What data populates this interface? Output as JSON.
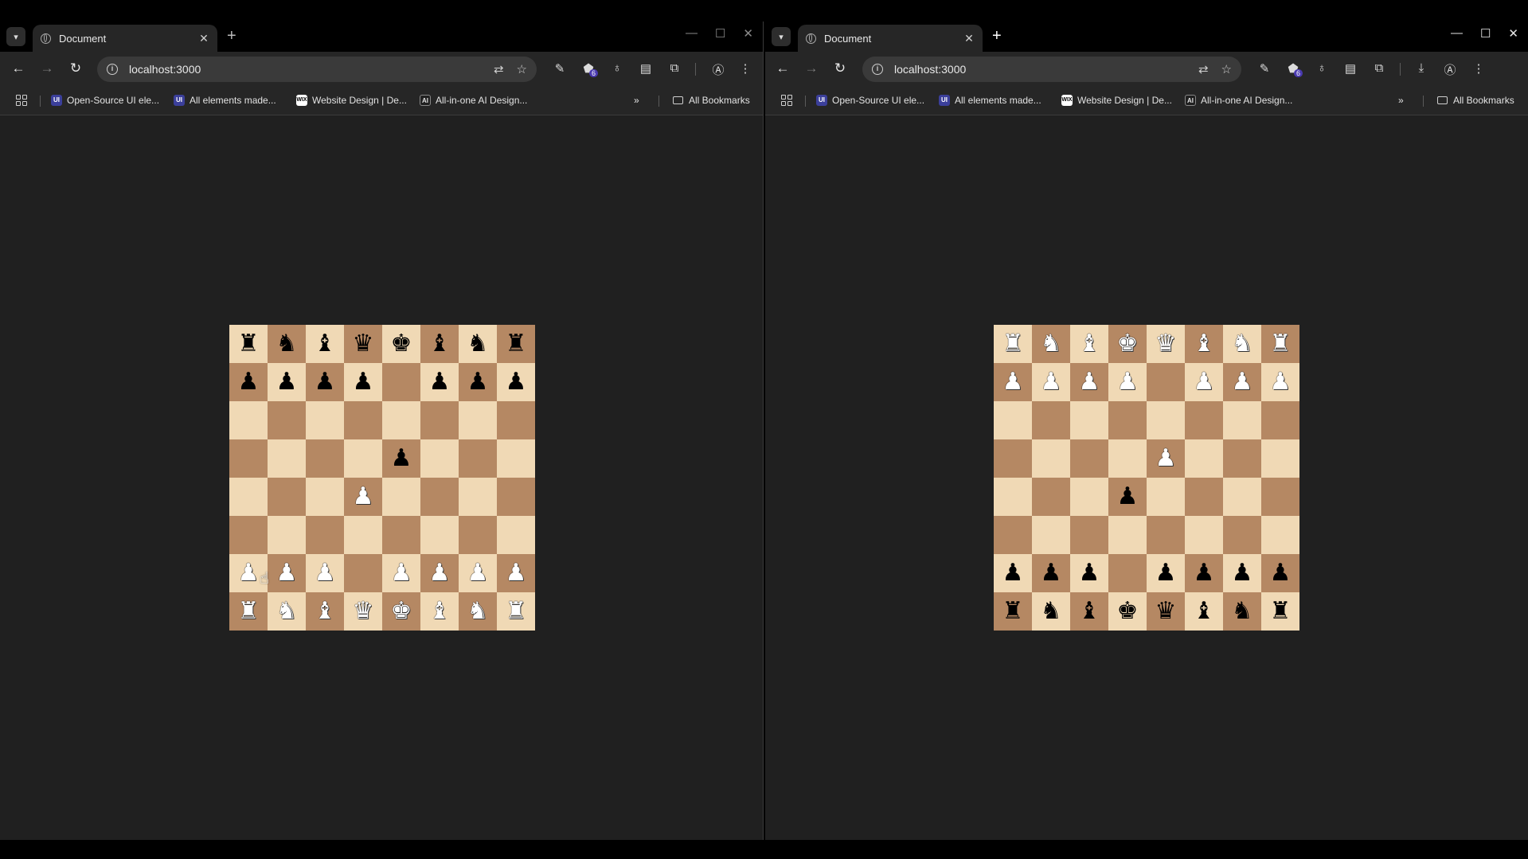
{
  "left": {
    "tab": {
      "title": "Document"
    },
    "toolbar": {
      "url": "localhost:3000"
    },
    "bookmarks": [
      {
        "icon": "UI",
        "label": "Open-Source UI ele..."
      },
      {
        "icon": "UI",
        "label": "All elements made..."
      },
      {
        "icon": "WIX",
        "label": "Website Design | De..."
      },
      {
        "icon": "AI",
        "label": "All-in-one AI Design..."
      }
    ],
    "all_bookmarks": "All Bookmarks",
    "extension_badge": "6",
    "board": [
      [
        "br",
        "bn",
        "bb",
        "bq",
        "bk",
        "bb",
        "bn",
        "br"
      ],
      [
        "bp",
        "bp",
        "bp",
        "bp",
        "",
        "bp",
        "bp",
        "bp"
      ],
      [
        "",
        "",
        "",
        "",
        "",
        "",
        "",
        ""
      ],
      [
        "",
        "",
        "",
        "",
        "bp",
        "",
        "",
        ""
      ],
      [
        "",
        "",
        "",
        "wp",
        "",
        "",
        "",
        ""
      ],
      [
        "",
        "",
        "",
        "",
        "",
        "",
        "",
        ""
      ],
      [
        "wp",
        "wp",
        "wp",
        "",
        "wp",
        "wp",
        "wp",
        "wp"
      ],
      [
        "wr",
        "wn",
        "wb",
        "wq",
        "wk",
        "wb",
        "wn",
        "wr"
      ]
    ]
  },
  "right": {
    "tab": {
      "title": "Document"
    },
    "toolbar": {
      "url": "localhost:3000"
    },
    "bookmarks": [
      {
        "icon": "UI",
        "label": "Open-Source UI ele..."
      },
      {
        "icon": "UI",
        "label": "All elements made..."
      },
      {
        "icon": "WIX",
        "label": "Website Design | De..."
      },
      {
        "icon": "AI",
        "label": "All-in-one AI Design..."
      }
    ],
    "all_bookmarks": "All Bookmarks",
    "extension_badge": "6",
    "board": [
      [
        "wr",
        "wn",
        "wb",
        "wk",
        "wq",
        "wb",
        "wn",
        "wr"
      ],
      [
        "wp",
        "wp",
        "wp",
        "wp",
        "",
        "wp",
        "wp",
        "wp"
      ],
      [
        "",
        "",
        "",
        "",
        "",
        "",
        "",
        ""
      ],
      [
        "",
        "",
        "",
        "",
        "wp",
        "",
        "",
        ""
      ],
      [
        "",
        "",
        "",
        "bp",
        "",
        "",
        "",
        ""
      ],
      [
        "",
        "",
        "",
        "",
        "",
        "",
        "",
        ""
      ],
      [
        "bp",
        "bp",
        "bp",
        "",
        "bp",
        "bp",
        "bp",
        "bp"
      ],
      [
        "br",
        "bn",
        "bb",
        "bk",
        "bq",
        "bb",
        "bn",
        "br"
      ]
    ]
  },
  "colors": {
    "light_square": "#f0d9b5",
    "dark_square": "#b58863",
    "page_bg": "#202020"
  }
}
